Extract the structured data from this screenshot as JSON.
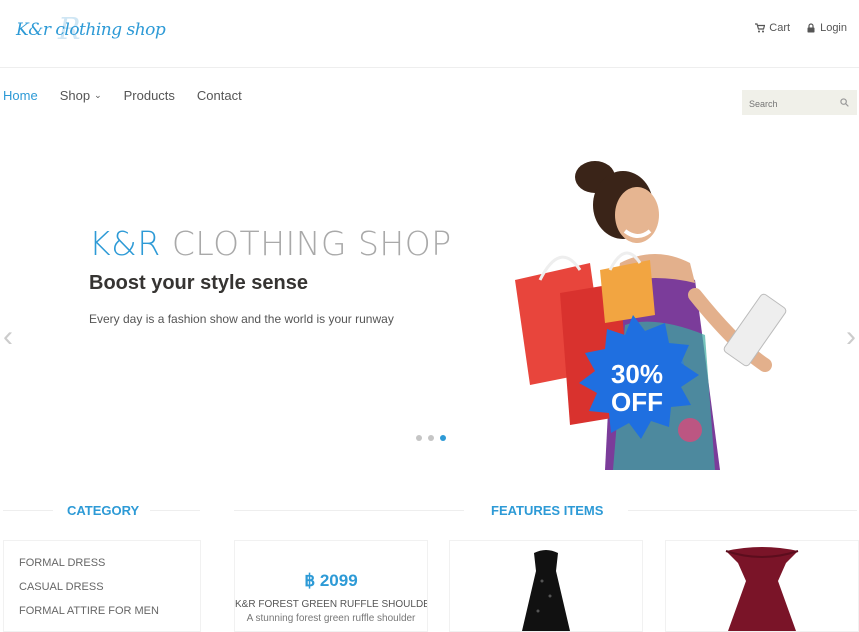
{
  "header": {
    "logo_text": "K&r clothing shop",
    "logo_mark": "R",
    "links": [
      {
        "label": "Cart",
        "icon": "cart-icon"
      },
      {
        "label": "Login",
        "icon": "lock-icon"
      }
    ]
  },
  "nav": {
    "items": [
      {
        "label": "Home",
        "active": true
      },
      {
        "label": "Shop",
        "has_dropdown": true
      },
      {
        "label": "Products"
      },
      {
        "label": "Contact"
      }
    ],
    "search_placeholder": "Search"
  },
  "hero": {
    "brand_accent": "K&R",
    "brand_rest": "CLOTHING SHOP",
    "heading": "Boost your style sense",
    "text": "Every day is a fashion show and the world is your runway",
    "badge_line1": "30%",
    "badge_line2": "OFF",
    "prev": "‹",
    "next": "›",
    "slide_count": 3,
    "active_slide": 3
  },
  "sections": {
    "category_title": "CATEGORY",
    "features_title": "FEATURES ITEMS"
  },
  "categories": [
    "FORMAL DRESS",
    "CASUAL DRESS",
    "FORMAL ATTIRE FOR MEN"
  ],
  "products": [
    {
      "price": "฿ 2099",
      "name": "K&R FOREST GREEN RUFFLE SHOULDER",
      "desc": "A stunning forest green ruffle shoulder"
    },
    {
      "image": "black-sequin-dress"
    },
    {
      "image": "burgundy-off-shoulder-dress"
    }
  ],
  "colors": {
    "accent": "#2d9ad6",
    "badge": "#1f6fe0",
    "bag_red": "#e8453c",
    "bag_orange": "#f2a541",
    "dress_burgundy": "#7a1428"
  }
}
